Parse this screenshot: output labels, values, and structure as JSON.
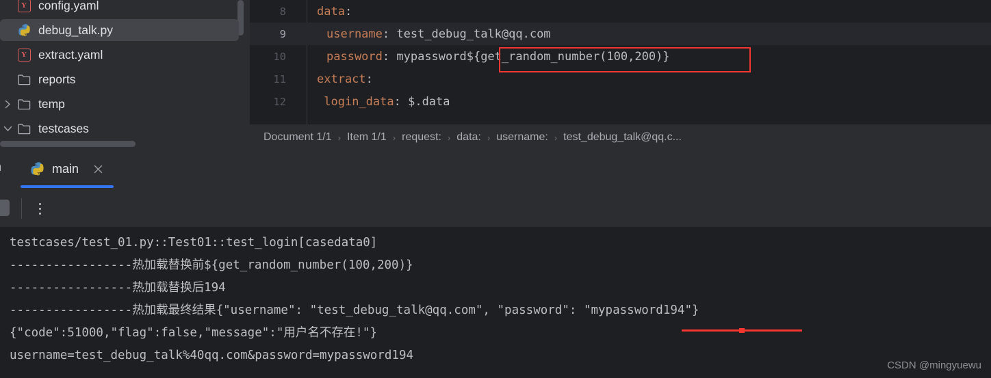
{
  "project_tree": {
    "items": [
      {
        "label": "config.yaml",
        "icon": "yaml-file-icon",
        "arrow": "",
        "selected": false
      },
      {
        "label": "debug_talk.py",
        "icon": "python-file-icon",
        "arrow": "",
        "selected": true
      },
      {
        "label": "extract.yaml",
        "icon": "yaml-file-icon",
        "arrow": "",
        "selected": false
      },
      {
        "label": "reports",
        "icon": "folder-icon",
        "arrow": "",
        "selected": false
      },
      {
        "label": "temp",
        "icon": "folder-icon",
        "arrow": "right",
        "selected": false
      },
      {
        "label": "testcases",
        "icon": "folder-icon",
        "arrow": "down",
        "selected": false
      }
    ]
  },
  "editor": {
    "lines": [
      {
        "number": "8",
        "indent": 2,
        "key": "data",
        "value": "",
        "current": false
      },
      {
        "number": "9",
        "indent": 3,
        "key": "username",
        "value": "test_debug_talk@qq.com",
        "current": true
      },
      {
        "number": "10",
        "indent": 3,
        "key": "password",
        "value": "mypassword${get_random_number(100,200)}",
        "current": false
      },
      {
        "number": "11",
        "indent": 2,
        "key": "extract",
        "value": "",
        "current": false
      },
      {
        "number": "12",
        "indent": 2,
        "key": "login_data",
        "value": "$.data",
        "current": false
      }
    ],
    "highlight_expression": "${get_random_number(100,200)}",
    "highlight_color": "#f3362f"
  },
  "breadcrumb": {
    "separator": "›",
    "items": [
      "Document 1/1",
      "Item 1/1",
      "request:",
      "data:",
      "username:",
      "test_debug_talk@qq.c..."
    ]
  },
  "run_panel": {
    "partial_tab_label": "n",
    "tab": {
      "label": "main",
      "icon": "python-file-icon",
      "close_icon": "close-icon"
    },
    "toolbar": {
      "stop_button": "stop-button",
      "more_button": "more-options-icon"
    },
    "console_lines": [
      "testcases/test_01.py::Test01::test_login[casedata0]",
      "-----------------热加载替换前${get_random_number(100,200)}",
      "-----------------热加载替换后194",
      "-----------------热加载最终结果{\"username\": \"test_debug_talk@qq.com\", \"password\": \"mypassword194\"}",
      "{\"code\":51000,\"flag\":false,\"message\":\"用户名不存在!\"}",
      "username=test_debug_talk%40qq.com&password=mypassword194"
    ],
    "annotation_color": "#f3362f"
  },
  "watermark": {
    "text": "CSDN @mingyuewu"
  },
  "theme": {
    "background": "#1e1f22",
    "panel": "#2b2d30",
    "accent": "#3574f0",
    "key_color": "#c77d55",
    "text_color": "#bcbec4",
    "muted": "#6e727a"
  }
}
